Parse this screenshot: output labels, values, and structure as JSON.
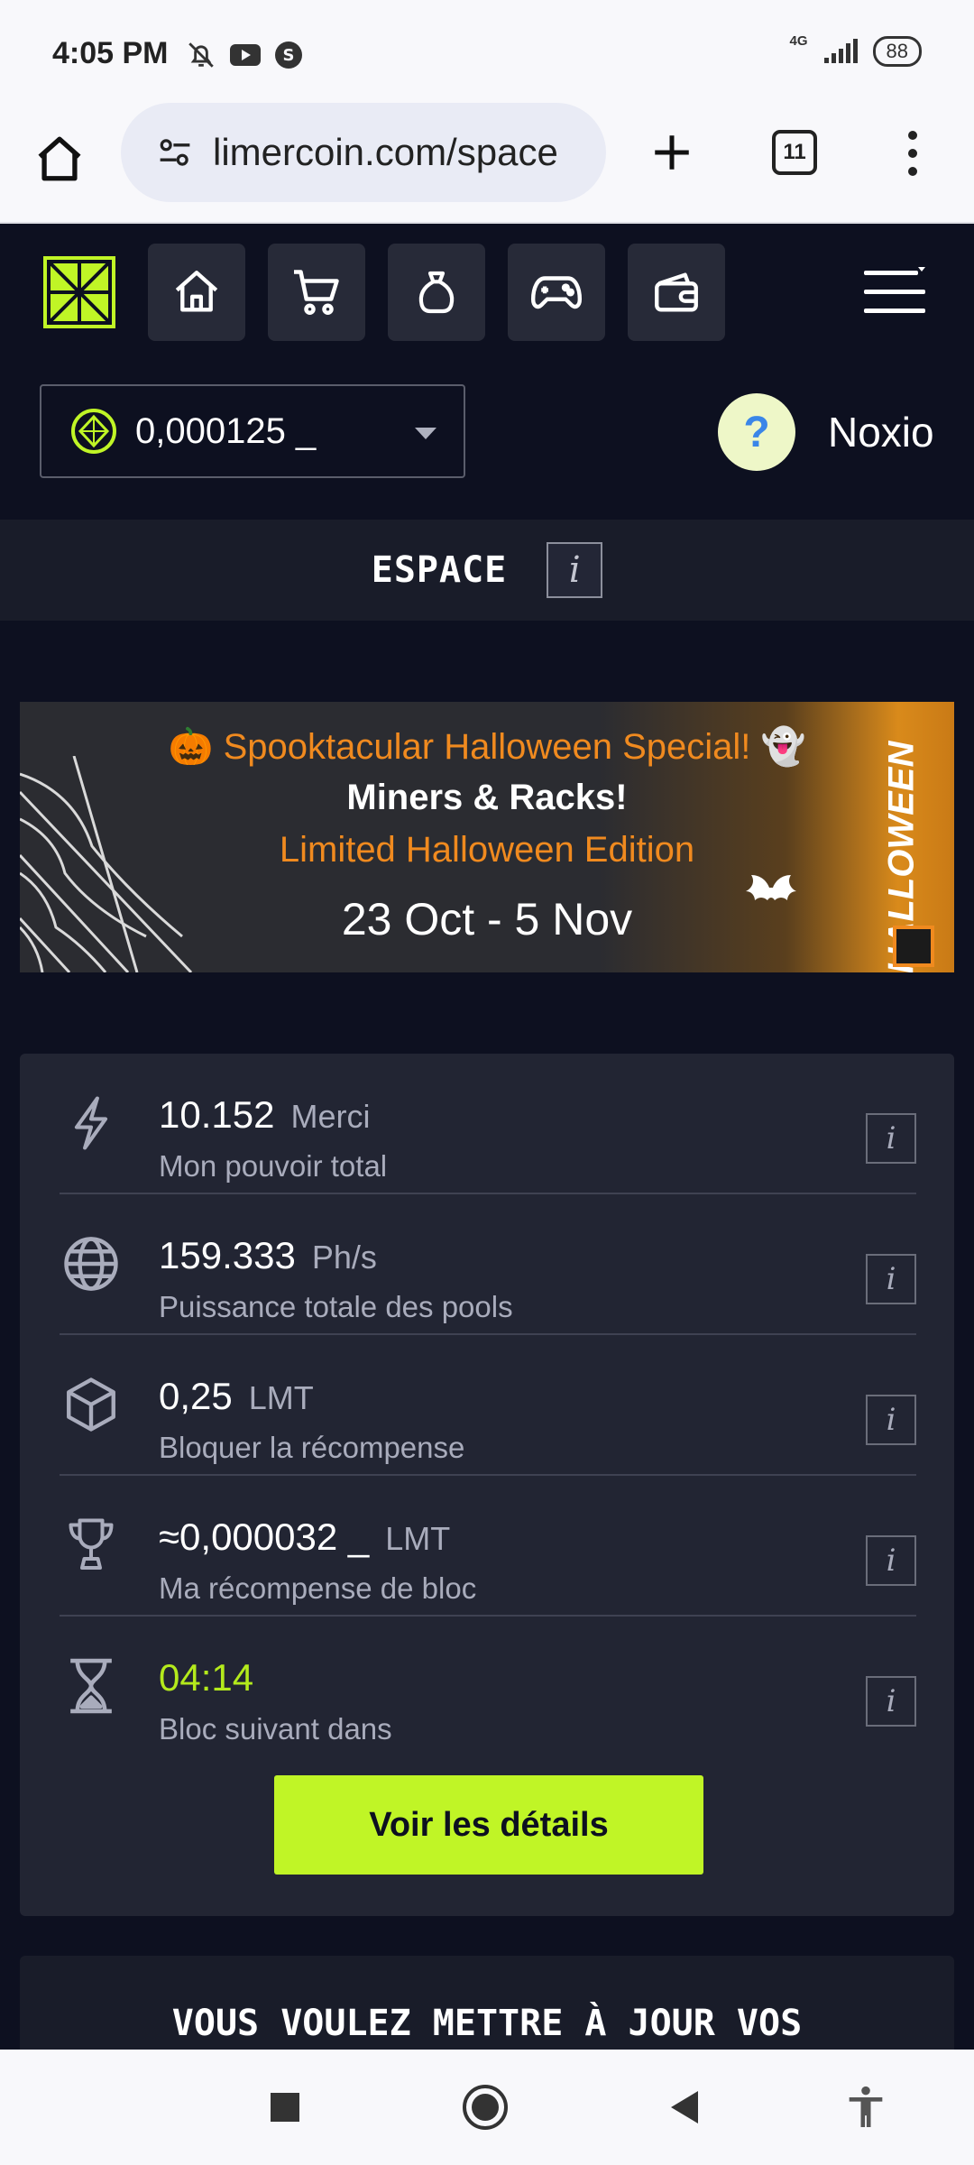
{
  "status_bar": {
    "time": "4:05 PM",
    "network": "4G",
    "battery": "88",
    "icons": [
      "bell-off-icon",
      "youtube-icon",
      "s-app-icon",
      "signal-icon"
    ]
  },
  "browser": {
    "url": "limercoin.com/space",
    "tab_count": "11"
  },
  "header": {
    "nav_icons": [
      "home-icon",
      "cart-icon",
      "bag-icon",
      "gamepad-icon",
      "wallet-icon"
    ],
    "balance": "0,000125 _",
    "username": "Noxio"
  },
  "page": {
    "title": "ESPACE"
  },
  "banner": {
    "line1": "🎃 Spooktacular Halloween Special! 👻",
    "line2": "Miners & Racks!",
    "line3": "Limited Halloween Edition",
    "line4": "23 Oct - 5 Nov",
    "side_text": "HALLOWEEN"
  },
  "stats": [
    {
      "icon": "lightning-icon",
      "value": "10.152",
      "unit": "Merci",
      "label": "Mon pouvoir total"
    },
    {
      "icon": "globe-icon",
      "value": "159.333",
      "unit": "Ph/s",
      "label": "Puissance totale des pools"
    },
    {
      "icon": "cube-icon",
      "value": "0,25",
      "unit": "LMT",
      "label": "Bloquer la récompense"
    },
    {
      "icon": "trophy-icon",
      "value": "≈0,000032 _",
      "unit": "LMT",
      "label": "Ma récompense de bloc"
    },
    {
      "icon": "hourglass-icon",
      "value": "04:14",
      "unit": "",
      "label": "Bloc suivant dans"
    }
  ],
  "cta_label": "Voir les détails",
  "upgrade_title": "VOUS VOULEZ METTRE À JOUR VOS",
  "colors": {
    "accent": "#c0f526",
    "background": "#0d1020",
    "card": "#222533",
    "banner_orange": "#f08a1f"
  }
}
